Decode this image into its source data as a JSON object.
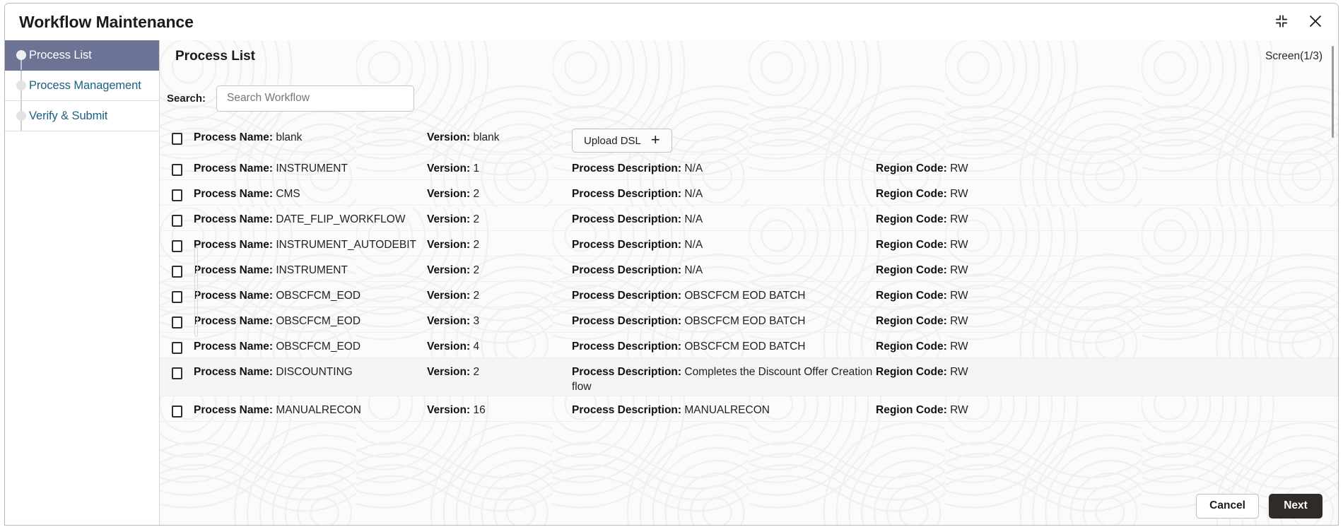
{
  "window": {
    "title": "Workflow Maintenance",
    "minimize_icon": "collapse-corners-icon",
    "close_icon": "close-icon"
  },
  "sidebar": {
    "items": [
      {
        "label": "Process List",
        "active": true
      },
      {
        "label": "Process Management",
        "active": false
      },
      {
        "label": "Verify & Submit",
        "active": false
      }
    ]
  },
  "main": {
    "title": "Process List",
    "screen_counter": "Screen(1/3)",
    "search": {
      "label": "Search:",
      "placeholder": "Search Workflow",
      "value": ""
    },
    "upload_button": {
      "label": "Upload DSL",
      "icon": "plus-icon"
    },
    "labels": {
      "process_name": "Process Name:",
      "version": "Version:",
      "process_description": "Process Description:",
      "region_code": "Region Code:"
    },
    "rows": [
      {
        "process_name": "blank",
        "version": "blank",
        "description": null,
        "region_code": null,
        "has_upload": true,
        "highlight": false
      },
      {
        "process_name": "INSTRUMENT",
        "version": "1",
        "description": "N/A",
        "region_code": "RW",
        "has_upload": false,
        "highlight": false
      },
      {
        "process_name": "CMS",
        "version": "2",
        "description": "N/A",
        "region_code": "RW",
        "has_upload": false,
        "highlight": false
      },
      {
        "process_name": "DATE_FLIP_WORKFLOW",
        "version": "2",
        "description": "N/A",
        "region_code": "RW",
        "has_upload": false,
        "highlight": false
      },
      {
        "process_name": "INSTRUMENT_AUTODEBIT",
        "version": "2",
        "description": "N/A",
        "region_code": "RW",
        "has_upload": false,
        "highlight": false
      },
      {
        "process_name": "INSTRUMENT",
        "version": "2",
        "description": "N/A",
        "region_code": "RW",
        "has_upload": false,
        "highlight": false
      },
      {
        "process_name": "OBSCFCM_EOD",
        "version": "2",
        "description": "OBSCFCM EOD BATCH",
        "region_code": "RW",
        "has_upload": false,
        "highlight": false
      },
      {
        "process_name": "OBSCFCM_EOD",
        "version": "3",
        "description": "OBSCFCM EOD BATCH",
        "region_code": "RW",
        "has_upload": false,
        "highlight": false
      },
      {
        "process_name": "OBSCFCM_EOD",
        "version": "4",
        "description": "OBSCFCM EOD BATCH",
        "region_code": "RW",
        "has_upload": false,
        "highlight": false
      },
      {
        "process_name": "DISCOUNTING",
        "version": "2",
        "description": "Completes the Discount Offer Creation flow",
        "region_code": "RW",
        "has_upload": false,
        "highlight": true
      },
      {
        "process_name": "MANUALRECON",
        "version": "16",
        "description": "MANUALRECON",
        "region_code": "RW",
        "has_upload": false,
        "highlight": false
      }
    ]
  },
  "footer": {
    "cancel_label": "Cancel",
    "next_label": "Next"
  },
  "colors": {
    "accent_active": "#6c7394",
    "link": "#1c6183",
    "primary_button": "#2e2b29",
    "text": "#1b1b1b"
  }
}
